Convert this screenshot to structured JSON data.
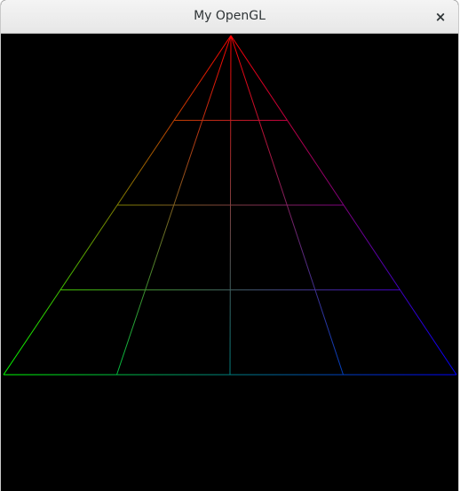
{
  "window": {
    "title": "My OpenGL",
    "close_glyph": "×"
  },
  "scene": {
    "background": "#000000",
    "apex_color": "#ff0000",
    "left_color": "#00ff00",
    "right_color": "#0000ff",
    "grid_divisions": 4
  }
}
